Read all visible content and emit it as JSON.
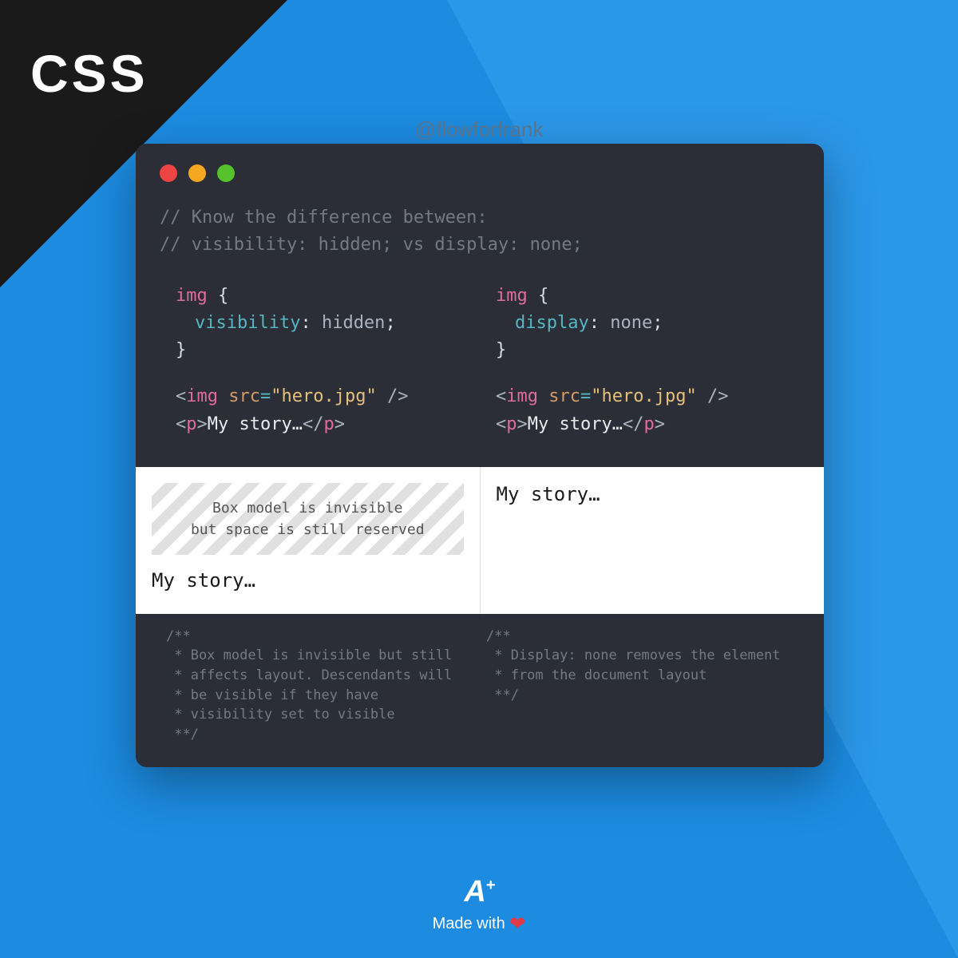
{
  "corner": {
    "label": "CSS"
  },
  "handle": "@flowforfrank",
  "comments": {
    "line1": "// Know the difference between:",
    "line2": "// visibility: hidden; vs display: none;"
  },
  "code": {
    "left": {
      "selector": "img",
      "brace_open": "{",
      "property": "visibility",
      "colon": ":",
      "value": "hidden",
      "semi": ";",
      "brace_close": "}",
      "img_open_ang": "<",
      "img_tag": "img",
      "img_attr": "src",
      "img_eq": "=",
      "img_str": "\"hero.jpg\"",
      "img_close": " />",
      "p_open_ang": "<",
      "p_tag": "p",
      "p_open_close": ">",
      "p_text": "My story…",
      "p_close_ang": "</",
      "p_close_tag": "p",
      "p_close_close": ">"
    },
    "right": {
      "selector": "img",
      "brace_open": "{",
      "property": "display",
      "colon": ":",
      "value": "none",
      "semi": ";",
      "brace_close": "}",
      "img_open_ang": "<",
      "img_tag": "img",
      "img_attr": "src",
      "img_eq": "=",
      "img_str": "\"hero.jpg\"",
      "img_close": " />",
      "p_open_ang": "<",
      "p_tag": "p",
      "p_open_close": ">",
      "p_text": "My story…",
      "p_close_ang": "</",
      "p_close_tag": "p",
      "p_close_close": ">"
    }
  },
  "preview": {
    "left": {
      "box_line1": "Box model is invisible",
      "box_line2": "but space is still reserved",
      "story": "My story…"
    },
    "right": {
      "story": "My story…"
    }
  },
  "notes": {
    "left": "/**\n * Box model is invisible but still\n * affects layout. Descendants will\n * be visible if they have\n * visibility set to visible\n **/",
    "right": "/**\n * Display: none removes the element\n * from the document layout\n **/"
  },
  "footer": {
    "logo_main": "A",
    "logo_plus": "+",
    "made": "Made with ",
    "heart": "❤"
  }
}
